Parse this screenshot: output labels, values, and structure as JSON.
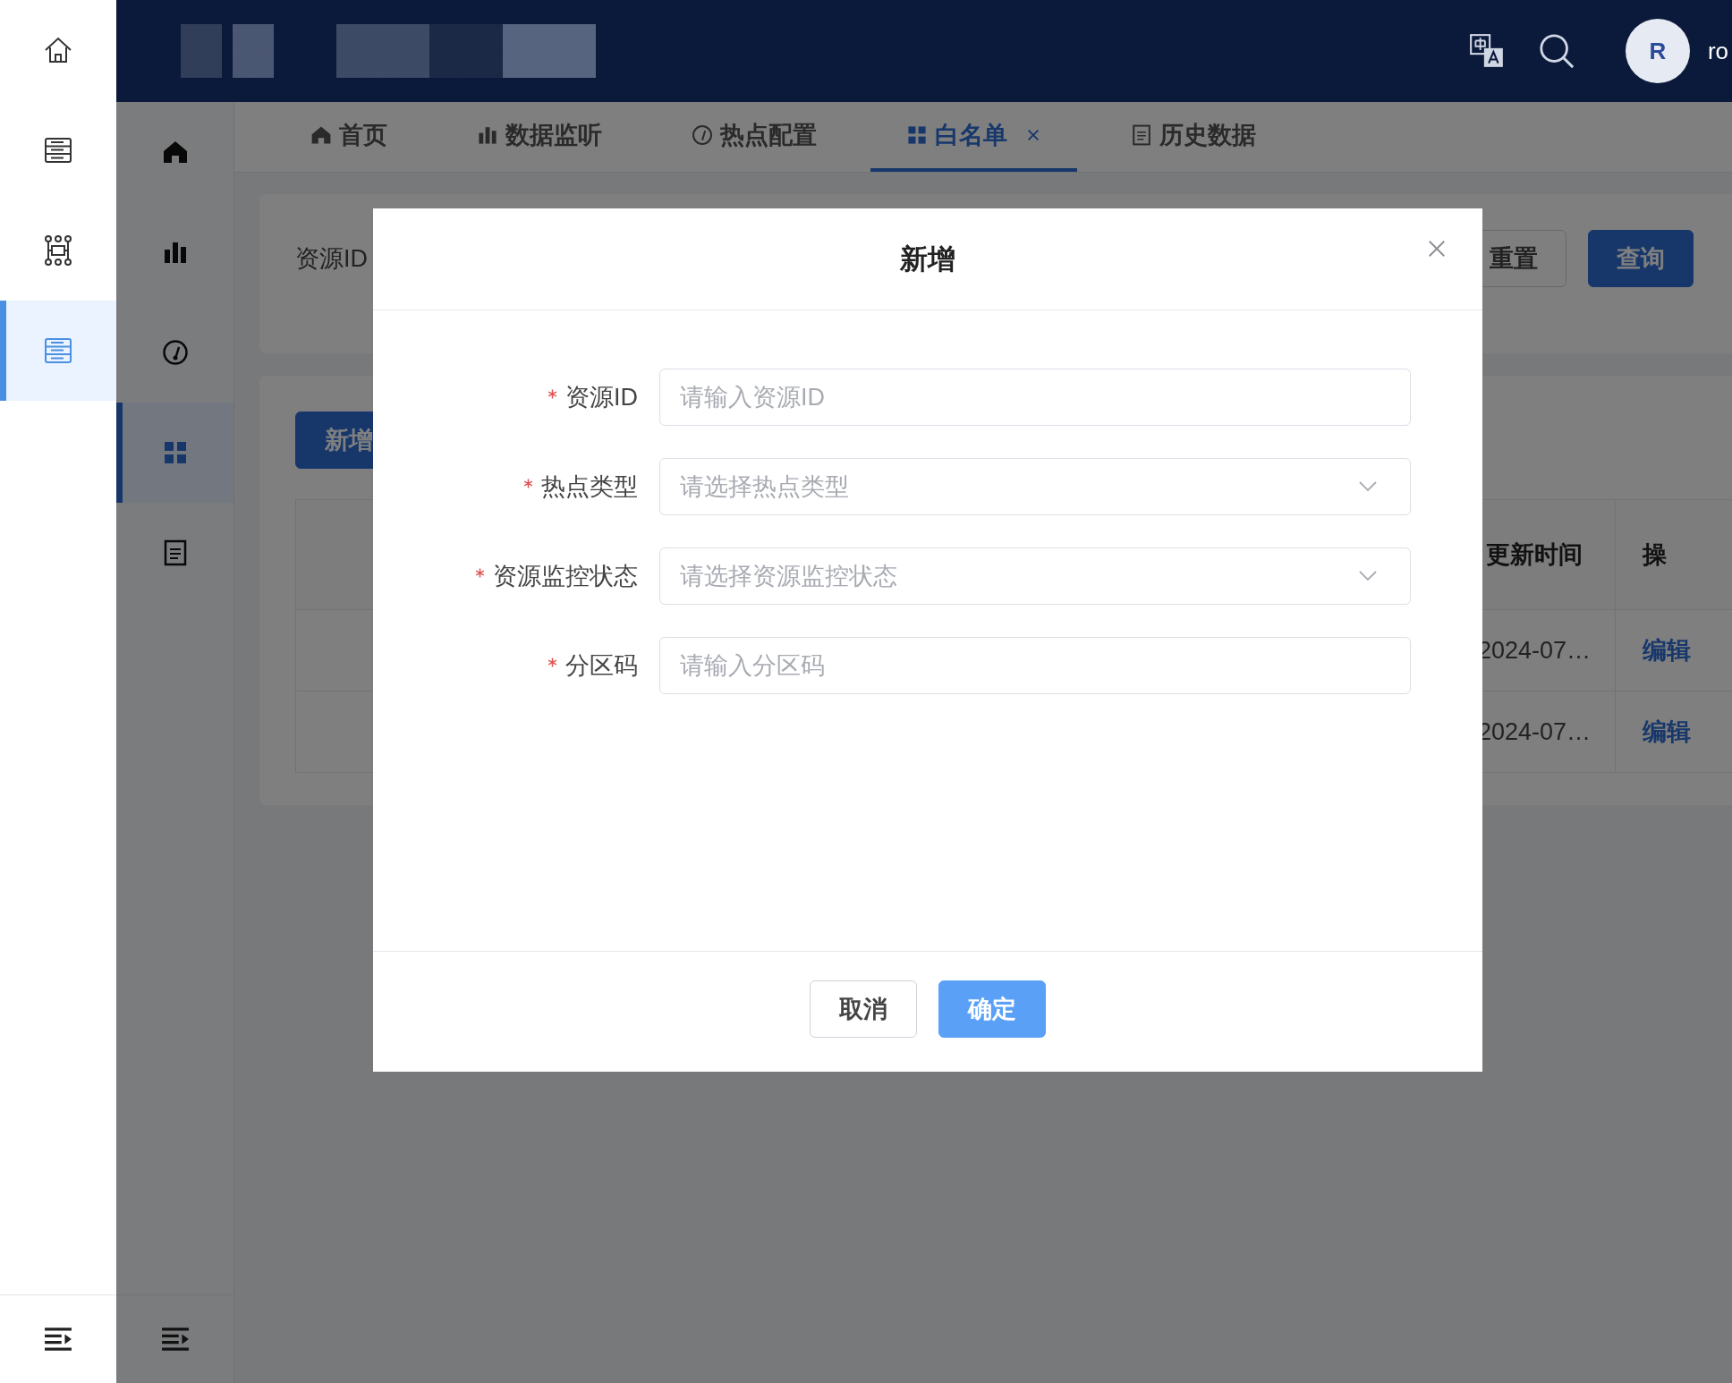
{
  "rail": {
    "items": [
      {
        "selected": false
      },
      {
        "selected": false
      },
      {
        "selected": false
      },
      {
        "selected": true
      }
    ]
  },
  "header": {
    "avatar": "R",
    "user_name": "ro"
  },
  "sidebar": {
    "items": [
      {
        "selected": false
      },
      {
        "selected": false
      },
      {
        "selected": false
      },
      {
        "selected": true
      },
      {
        "selected": false
      }
    ]
  },
  "tabs": [
    {
      "label": "首页",
      "selected": false,
      "closable": false
    },
    {
      "label": "数据监听",
      "selected": false,
      "closable": false
    },
    {
      "label": "热点配置",
      "selected": false,
      "closable": false
    },
    {
      "label": "白名单",
      "selected": true,
      "closable": true
    },
    {
      "label": "历史数据",
      "selected": false,
      "closable": false
    }
  ],
  "search": {
    "label": "资源ID",
    "buttons": [
      {
        "label": "重置",
        "kind": "default"
      },
      {
        "label": "查询",
        "kind": "primary"
      }
    ]
  },
  "toolbar": {
    "add_button": "新增"
  },
  "table": {
    "columns": [
      "更新时间",
      "操"
    ],
    "rows": [
      {
        "updated": "2024-07…",
        "action": "编辑"
      },
      {
        "updated": "2024-07…",
        "action": "编辑"
      }
    ]
  },
  "dialog": {
    "title": "新增",
    "fields": [
      {
        "label": "资源ID",
        "required": true,
        "kind": "input",
        "placeholder": "请输入资源ID"
      },
      {
        "label": "热点类型",
        "required": true,
        "kind": "select",
        "placeholder": "请选择热点类型"
      },
      {
        "label": "资源监控状态",
        "required": true,
        "kind": "select",
        "placeholder": "请选择资源监控状态"
      },
      {
        "label": "分区码",
        "required": true,
        "kind": "input",
        "placeholder": "请输入分区码"
      }
    ],
    "buttons": [
      {
        "label": "取消",
        "kind": "default"
      },
      {
        "label": "确定",
        "kind": "primary"
      }
    ]
  }
}
